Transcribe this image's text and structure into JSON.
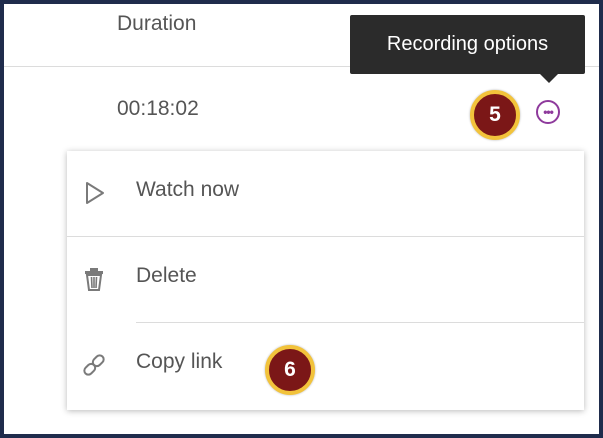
{
  "table": {
    "column_header": "Duration",
    "rows": [
      {
        "duration": "00:18:02"
      }
    ]
  },
  "options_button": {
    "icon": "more-options-icon",
    "glyph": "•••",
    "color": "#8e3a9c"
  },
  "tooltip": {
    "text": "Recording options"
  },
  "callouts": {
    "step_5": "5",
    "step_6": "6",
    "fill_color": "#7b1717",
    "ring_color": "#f2c33b"
  },
  "menu": {
    "items": [
      {
        "label": "Watch now",
        "icon": "play-icon"
      },
      {
        "label": "Delete",
        "icon": "trash-icon"
      },
      {
        "label": "Copy link",
        "icon": "link-icon"
      }
    ]
  },
  "colors": {
    "frame_border": "#1f2c4c",
    "tooltip_bg": "#2b2b2b",
    "text": "#555555"
  }
}
